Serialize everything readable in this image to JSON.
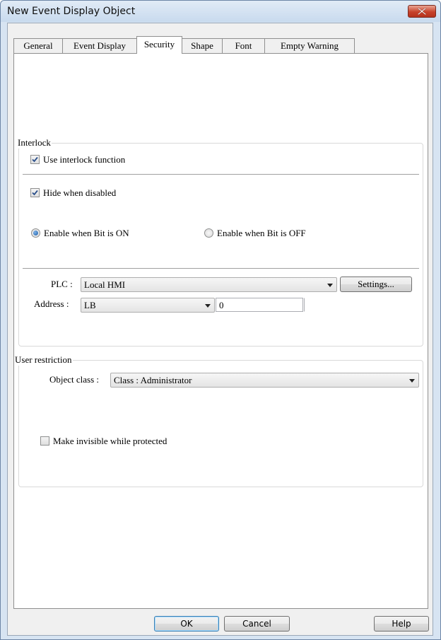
{
  "window": {
    "title": "New Event Display Object"
  },
  "tabs": [
    {
      "label": "General"
    },
    {
      "label": "Event Display"
    },
    {
      "label": "Security"
    },
    {
      "label": "Shape"
    },
    {
      "label": "Font"
    },
    {
      "label": "Empty Warning"
    }
  ],
  "active_tab": "Security",
  "interlock": {
    "group_label": "Interlock",
    "use_interlock_label": "Use interlock function",
    "use_interlock_checked": true,
    "hide_when_disabled_label": "Hide when disabled",
    "hide_when_disabled_checked": true,
    "enable_on_label": "Enable when Bit is ON",
    "enable_off_label": "Enable when Bit is OFF",
    "selected_mode": "Enable when Bit is ON",
    "plc_label": "PLC :",
    "plc_value": "Local HMI",
    "settings_button": "Settings...",
    "address_label": "Address :",
    "address_device": "LB",
    "address_value": "0",
    "address_extra": ""
  },
  "user_restriction": {
    "group_label": "User restriction",
    "object_class_label": "Object class :",
    "object_class_value": "Class : Administrator",
    "make_invisible_label": "Make invisible while protected",
    "make_invisible_checked": false
  },
  "buttons": {
    "ok": "OK",
    "cancel": "Cancel",
    "help": "Help"
  },
  "colors": {
    "title_bar": "#d7e4f2",
    "close_button": "#c7422b",
    "default_button_border": "#3c7fb1"
  }
}
